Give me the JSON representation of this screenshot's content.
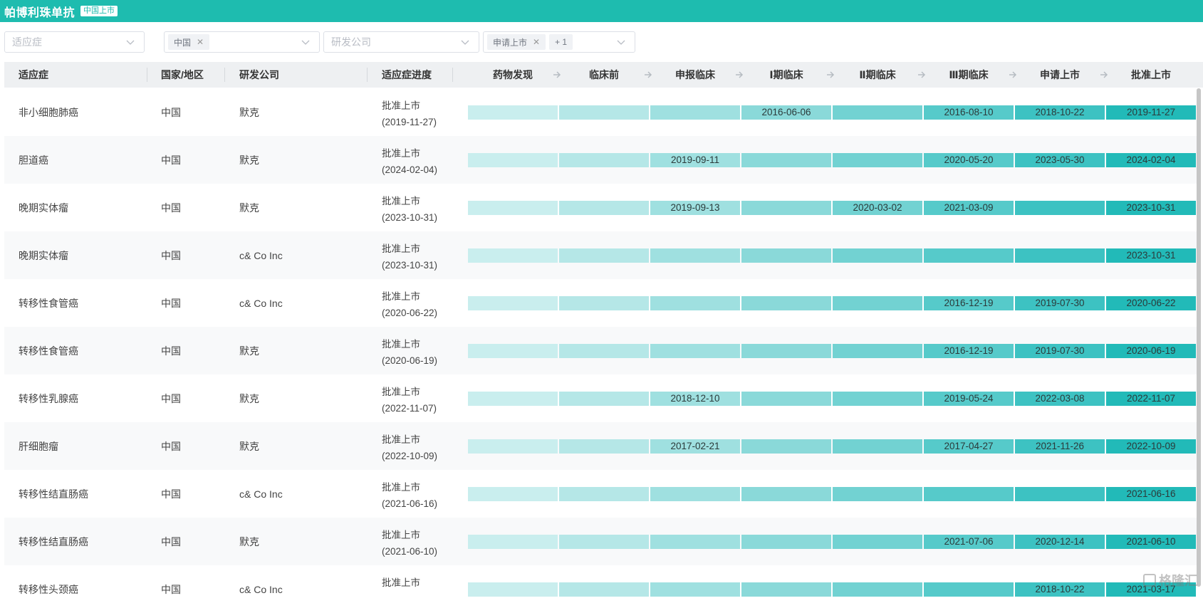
{
  "app": {
    "title": "帕博利珠单抗",
    "badge": "中国上市"
  },
  "filters": {
    "indication_placeholder": "适应症",
    "country_tag": "中国",
    "company_placeholder": "研发公司",
    "stage_tag": "申请上市",
    "stage_more": "+ 1"
  },
  "columns": {
    "indication": "适应症",
    "country": "国家/地区",
    "company": "研发公司",
    "progress": "适应症进度"
  },
  "stages": [
    "药物发现",
    "临床前",
    "申报临床",
    "Ⅰ期临床",
    "Ⅱ期临床",
    "Ⅲ期临床",
    "申请上市",
    "批准上市"
  ],
  "stage_colors": [
    "#c9eeee",
    "#b5e7e7",
    "#9fe0e0",
    "#8ad9d9",
    "#72d2d2",
    "#56caca",
    "#3dc2c2",
    "#22bab8"
  ],
  "rows": [
    {
      "indication": "非小细胞肺癌",
      "country": "中国",
      "company": "默克",
      "status": "批准上市",
      "date": "(2019-11-27)",
      "stages": [
        "",
        "",
        "",
        "2016-06-06",
        "",
        "2016-08-10",
        "2018-10-22",
        "2019-11-27"
      ]
    },
    {
      "indication": "胆道癌",
      "country": "中国",
      "company": "默克",
      "status": "批准上市",
      "date": "(2024-02-04)",
      "stages": [
        "",
        "",
        "2019-09-11",
        "",
        "",
        "2020-05-20",
        "2023-05-30",
        "2024-02-04"
      ]
    },
    {
      "indication": "晚期实体瘤",
      "country": "中国",
      "company": "默克",
      "status": "批准上市",
      "date": "(2023-10-31)",
      "stages": [
        "",
        "",
        "2019-09-13",
        "",
        "2020-03-02",
        "2021-03-09",
        "",
        "2023-10-31"
      ]
    },
    {
      "indication": "晚期实体瘤",
      "country": "中国",
      "company": "c& Co Inc",
      "status": "批准上市",
      "date": "(2023-10-31)",
      "stages": [
        "",
        "",
        "",
        "",
        "",
        "",
        "",
        "2023-10-31"
      ]
    },
    {
      "indication": "转移性食管癌",
      "country": "中国",
      "company": "c& Co Inc",
      "status": "批准上市",
      "date": "(2020-06-22)",
      "stages": [
        "",
        "",
        "",
        "",
        "",
        "2016-12-19",
        "2019-07-30",
        "2020-06-22"
      ]
    },
    {
      "indication": "转移性食管癌",
      "country": "中国",
      "company": "默克",
      "status": "批准上市",
      "date": "(2020-06-19)",
      "stages": [
        "",
        "",
        "",
        "",
        "",
        "2016-12-19",
        "2019-07-30",
        "2020-06-19"
      ]
    },
    {
      "indication": "转移性乳腺癌",
      "country": "中国",
      "company": "默克",
      "status": "批准上市",
      "date": "(2022-11-07)",
      "stages": [
        "",
        "",
        "2018-12-10",
        "",
        "",
        "2019-05-24",
        "2022-03-08",
        "2022-11-07"
      ]
    },
    {
      "indication": "肝细胞瘤",
      "country": "中国",
      "company": "默克",
      "status": "批准上市",
      "date": "(2022-10-09)",
      "stages": [
        "",
        "",
        "2017-02-21",
        "",
        "",
        "2017-04-27",
        "2021-11-26",
        "2022-10-09"
      ]
    },
    {
      "indication": "转移性结直肠癌",
      "country": "中国",
      "company": "c& Co Inc",
      "status": "批准上市",
      "date": "(2021-06-16)",
      "stages": [
        "",
        "",
        "",
        "",
        "",
        "",
        "",
        "2021-06-16"
      ]
    },
    {
      "indication": "转移性结直肠癌",
      "country": "中国",
      "company": "默克",
      "status": "批准上市",
      "date": "(2021-06-10)",
      "stages": [
        "",
        "",
        "",
        "",
        "",
        "2021-07-06",
        "2020-12-14",
        "2021-06-10"
      ]
    },
    {
      "indication": "转移性头颈癌",
      "country": "中国",
      "company": "c& Co Inc",
      "status": "批准上市",
      "date": "",
      "stages": [
        "",
        "",
        "",
        "",
        "",
        "",
        "2018-10-22",
        "2021-03-17"
      ]
    }
  ],
  "watermark": "格隆汇"
}
